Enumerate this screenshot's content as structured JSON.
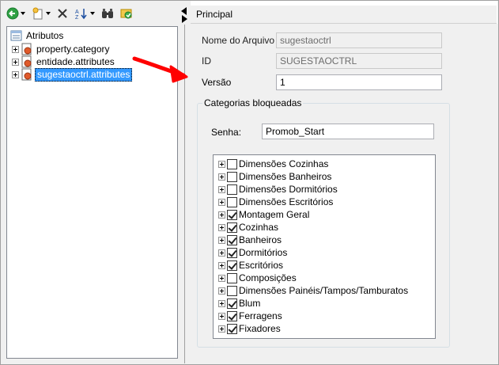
{
  "toolbar": {
    "items": [
      {
        "name": "back-icon",
        "color": "#2ea043"
      },
      {
        "name": "new-item-icon"
      },
      {
        "name": "delete-icon"
      },
      {
        "name": "sort-icon"
      },
      {
        "name": "find-icon"
      },
      {
        "name": "refresh-icon"
      }
    ]
  },
  "tree": {
    "root_label": "Atributos",
    "items": [
      {
        "label": "property.category"
      },
      {
        "label": "entidade.attributes"
      },
      {
        "label": "sugestaoctrl.attributes",
        "selected": true
      }
    ]
  },
  "section": {
    "title": "Principal"
  },
  "form": {
    "nome_label": "Nome do Arquivo",
    "nome_value": "sugestaoctrl",
    "id_label": "ID",
    "id_value": "SUGESTAOCTRL",
    "versao_label": "Versão",
    "versao_value": "1",
    "group_title": "Categorias bloqueadas",
    "senha_label": "Senha:",
    "senha_value": "Promob_Start"
  },
  "categories": [
    {
      "label": "Dimensões Cozinhas",
      "checked": false
    },
    {
      "label": "Dimensões Banheiros",
      "checked": false
    },
    {
      "label": "Dimensões Dormitórios",
      "checked": false
    },
    {
      "label": "Dimensões Escritórios",
      "checked": false
    },
    {
      "label": "Montagem Geral",
      "checked": true
    },
    {
      "label": "Cozinhas",
      "checked": true
    },
    {
      "label": "Banheiros",
      "checked": true
    },
    {
      "label": "Dormitórios",
      "checked": true
    },
    {
      "label": "Escritórios",
      "checked": true
    },
    {
      "label": "Composições",
      "checked": false
    },
    {
      "label": "Dimensões Painéis/Tampos/Tamburatos",
      "checked": false
    },
    {
      "label": "Blum",
      "checked": true
    },
    {
      "label": "Ferragens",
      "checked": true
    },
    {
      "label": "Fixadores",
      "checked": true
    }
  ],
  "colors": {
    "selection": "#3399ff",
    "annotation_arrow": "#ff0000"
  }
}
